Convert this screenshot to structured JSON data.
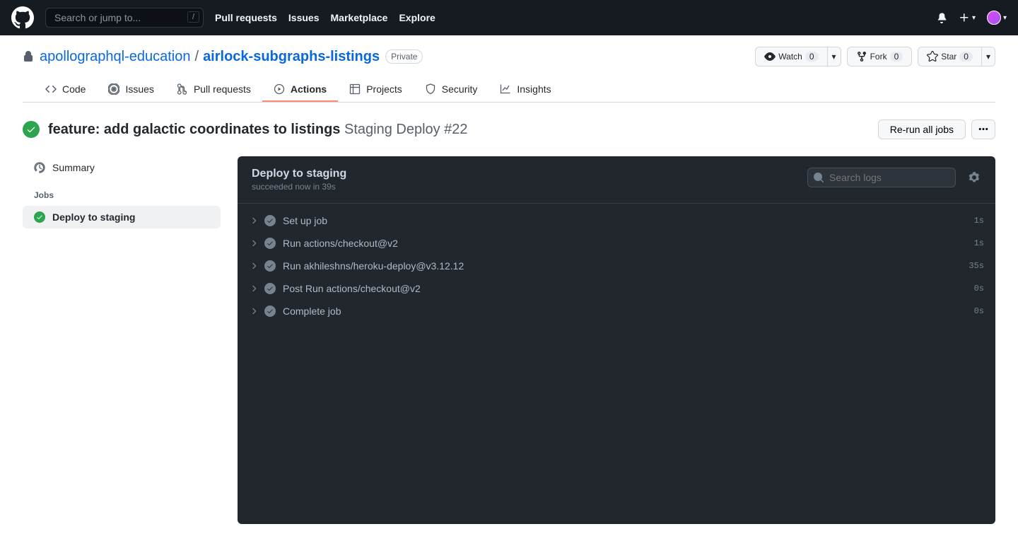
{
  "header": {
    "search_placeholder": "Search or jump to...",
    "slash": "/",
    "nav": [
      "Pull requests",
      "Issues",
      "Marketplace",
      "Explore"
    ]
  },
  "repo": {
    "owner": "apollographql-education",
    "name": "airlock-subgraphs-listings",
    "visibility": "Private",
    "watch_label": "Watch",
    "watch_count": "0",
    "fork_label": "Fork",
    "fork_count": "0",
    "star_label": "Star",
    "star_count": "0"
  },
  "tabs": [
    "Code",
    "Issues",
    "Pull requests",
    "Actions",
    "Projects",
    "Security",
    "Insights"
  ],
  "run": {
    "title": "feature: add galactic coordinates to listings",
    "workflow": "Staging Deploy #22",
    "rerun_label": "Re-run all jobs"
  },
  "sidebar": {
    "summary": "Summary",
    "jobs_header": "Jobs",
    "job_name": "Deploy to staging"
  },
  "log": {
    "title": "Deploy to staging",
    "subtitle": "succeeded now in 39s",
    "search_placeholder": "Search logs",
    "steps": [
      {
        "name": "Set up job",
        "time": "1s"
      },
      {
        "name": "Run actions/checkout@v2",
        "time": "1s"
      },
      {
        "name": "Run akhileshns/heroku-deploy@v3.12.12",
        "time": "35s"
      },
      {
        "name": "Post Run actions/checkout@v2",
        "time": "0s"
      },
      {
        "name": "Complete job",
        "time": "0s"
      }
    ]
  }
}
